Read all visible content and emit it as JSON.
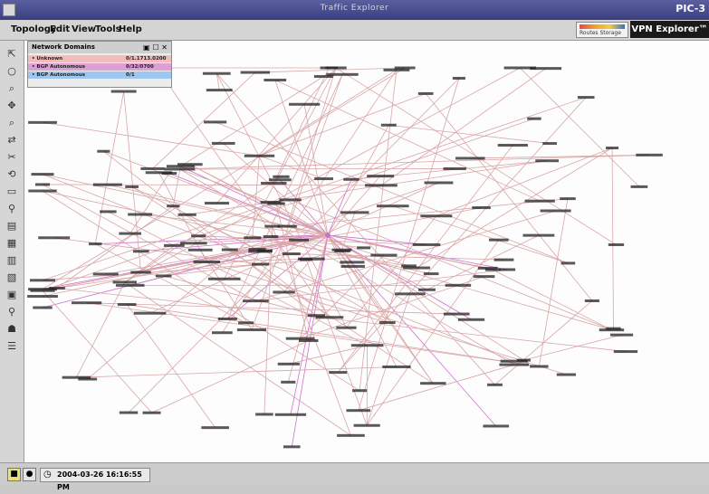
{
  "window": {
    "title": "Traffic Explorer",
    "corner_text": "PIC-3"
  },
  "menu": [
    "Topology",
    "Edit",
    "View",
    "Tools",
    "Help"
  ],
  "brand": "VPN Explorer™",
  "legend": {
    "label": "Routes Storage"
  },
  "panel": {
    "title": "Network Domains",
    "rows": [
      {
        "name": "• Unknown",
        "value": "0/1.1713.0200",
        "color": "#f2bcbc"
      },
      {
        "name": "• BGP Autonomous",
        "value": "0/32/0700",
        "color": "#dc9fd6"
      },
      {
        "name": "• BGP Autonomous",
        "value": "0/1",
        "color": "#9ec6ee"
      }
    ]
  },
  "tools": [
    "pointer-icon",
    "select-icon",
    "zoom-icon",
    "pan-icon",
    "search-icon",
    "route-icon",
    "cut-icon",
    "link-icon",
    "map-icon",
    "filter-icon",
    "layout-icon",
    "table-icon",
    "report-icon",
    "chart-icon",
    "grid-icon",
    "pin-icon",
    "group-icon",
    "settings-icon"
  ],
  "status": {
    "timestamp": "2004-03-26 16:16:55 PM"
  },
  "graph": {
    "edge_color": "#d9a6a6",
    "hub_color": "#cf6fd0",
    "node_color": "#222222"
  }
}
